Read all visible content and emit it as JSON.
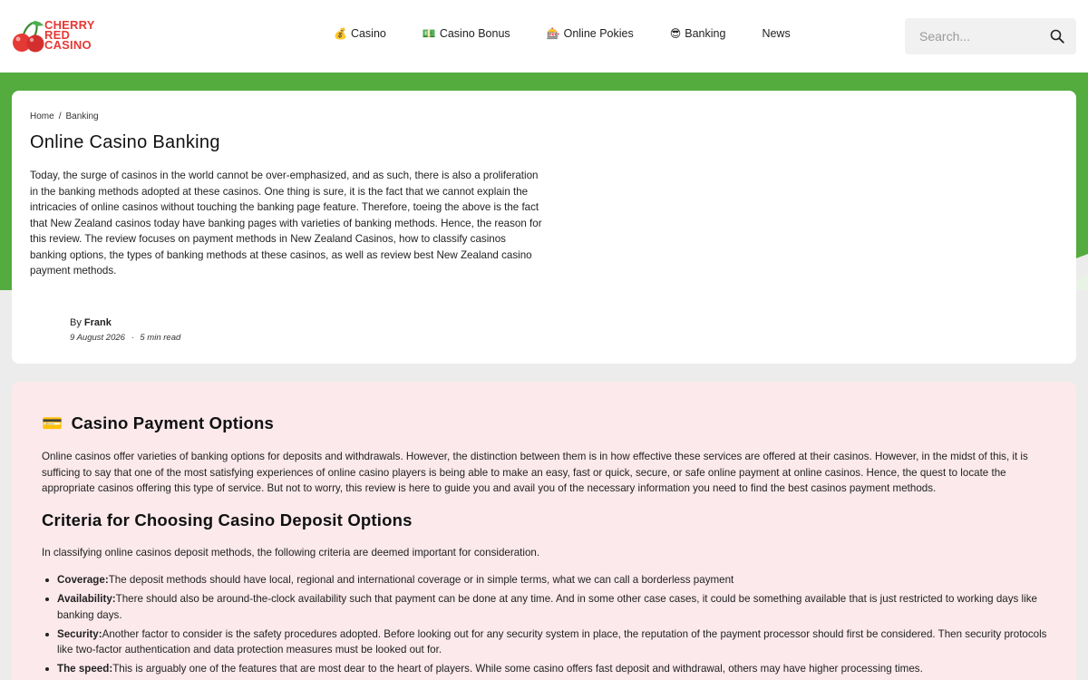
{
  "header": {
    "logo": {
      "line1": "CHERRY",
      "line2": "RED",
      "line3": "CASINO"
    },
    "nav": [
      {
        "icon": "💰",
        "label": "Casino"
      },
      {
        "icon": "💵",
        "label": "Casino Bonus"
      },
      {
        "icon": "🎰",
        "label": "Online Pokies"
      },
      {
        "icon": "😎",
        "label": "Banking"
      },
      {
        "icon": "",
        "label": "News"
      }
    ],
    "search": {
      "placeholder": "Search...",
      "icon": "search-icon"
    }
  },
  "colors": {
    "brand_red": "#e53935",
    "band_green": "#54ab3e",
    "content_pink": "#fbe9ec"
  },
  "article": {
    "breadcrumb": {
      "home": "Home",
      "separator": "/",
      "current": "Banking"
    },
    "title": "Online Casino Banking",
    "intro": "Today, the surge of casinos in the world cannot be over-emphasized, and as such, there is also a proliferation in the banking methods adopted at these casinos. One thing is sure, it is the fact that we cannot explain the intricacies of online casinos without touching the banking page feature. Therefore, toeing the above is the fact that New Zealand casinos today have banking pages with varieties of banking methods. Hence, the reason for this review. The review focuses on payment methods in New Zealand Casinos, how to classify casinos banking options, the types of banking methods at these casinos, as well as review best New Zealand casino payment methods.",
    "author_prefix": "By",
    "author": "Frank",
    "date": "9 August 2026",
    "meta_sep": "·",
    "read_time": "5 min read"
  },
  "content": {
    "section1": {
      "icon": "💳",
      "heading": "Casino Payment Options",
      "body": "Online casinos offer varieties of banking options for deposits and withdrawals. However, the distinction between them is in how effective these services are offered at their casinos. However, in the midst of this, it is sufficing to say that one of the most satisfying experiences of online casino players is being able to make an easy, fast or quick, secure, or safe online payment at online casinos. Hence, the quest to locate the appropriate casinos offering this type of service. But not to worry, this review is here to guide you and avail you of the necessary information you need to find the best casinos payment methods."
    },
    "section2": {
      "heading": "Criteria for Choosing Casino Deposit Options",
      "body": "In classifying online casinos deposit methods, the following criteria are deemed important for consideration.",
      "criteria": [
        {
          "term": "Coverage:",
          "text": "The deposit methods should have local, regional and international coverage or in simple terms, what we can call a borderless payment"
        },
        {
          "term": "Availability:",
          "text": "There should also be around-the-clock availability such that payment can be done at any time. And in some other case cases, it could be something available that is just restricted to working days like banking days."
        },
        {
          "term": "Security:",
          "text": "Another factor to consider is the safety procedures adopted. Before looking out for any security system in place, the reputation of the payment processor should first be considered. Then security protocols like two-factor authentication and data protection measures must be looked out for."
        },
        {
          "term": "The speed:",
          "text": "This is arguably one of the features that are most dear to the heart of players. While some casino offers fast deposit and withdrawal, others may have higher processing times."
        }
      ]
    }
  }
}
